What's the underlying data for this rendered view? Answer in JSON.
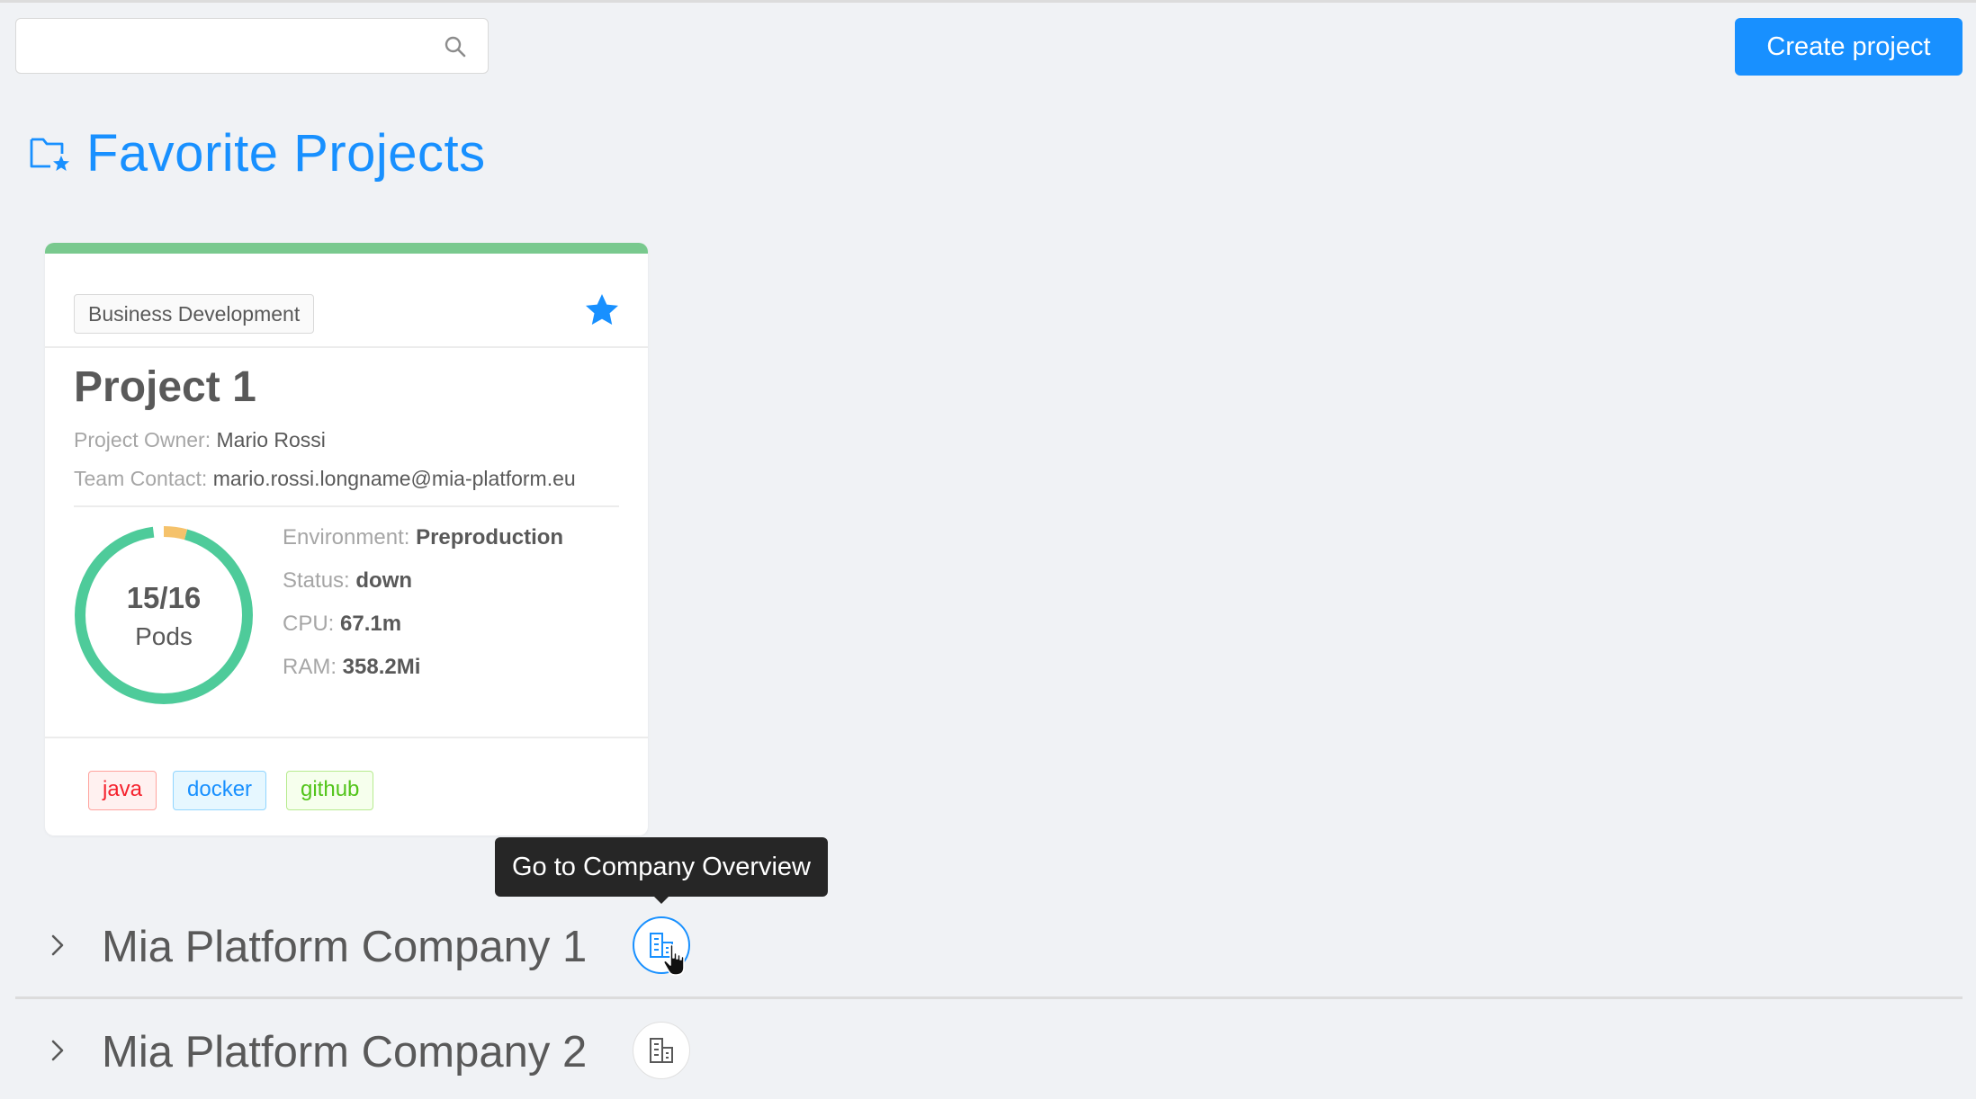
{
  "search": {
    "placeholder": "",
    "value": ""
  },
  "header": {
    "create_label": "Create project"
  },
  "favorites": {
    "title": "Favorite Projects",
    "card": {
      "category": "Business Development",
      "favorited": true,
      "title": "Project 1",
      "owner_label": "Project Owner:",
      "owner": "Mario Rossi",
      "contact_label": "Team Contact:",
      "contact": "mario.rossi.longname@mia-platform.eu",
      "pods": {
        "label": "15/16",
        "unit": "Pods",
        "ready": 15,
        "total": 16
      },
      "env_label": "Environment:",
      "env": "Preproduction",
      "status_label": "Status:",
      "status": "down",
      "cpu_label": "CPU:",
      "cpu": "67.1m",
      "ram_label": "RAM:",
      "ram": "358.2Mi",
      "tags": [
        "java",
        "docker",
        "github"
      ]
    }
  },
  "tooltip": {
    "text": "Go to Company Overview"
  },
  "companies": [
    {
      "name": "Mia Platform Company 1"
    },
    {
      "name": "Mia Platform Company 2"
    }
  ],
  "colors": {
    "primary": "#1890ff",
    "card_top": "#79c98e",
    "donut_ready": "#4ecb9a",
    "donut_pending": "#f5c26b"
  }
}
